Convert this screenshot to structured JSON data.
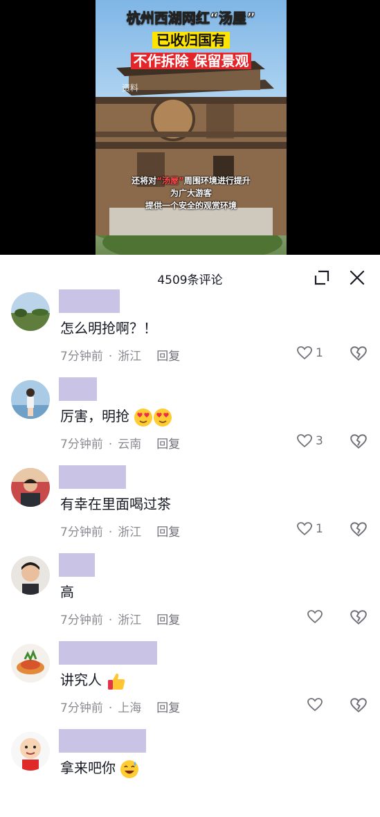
{
  "video": {
    "title_line1": "杭州西湖网红“汤屋”",
    "title_line2": "已收归国有",
    "title_line3": "不作拆除 保留景观",
    "watermark": "资料",
    "subtitle_prefix": "还将对",
    "subtitle_highlight": "“汤屋”",
    "subtitle_suffix": "周围环境进行提升",
    "subtitle_line2": "为广大游客",
    "subtitle_line3": "提供一个安全的观赏环境"
  },
  "panel": {
    "count_label": "4509条评论",
    "expand_icon": "expand-icon",
    "close_icon": "close-icon"
  },
  "colors": {
    "username_placeholder": "#c9c3e6",
    "text_primary": "#161823",
    "text_meta": "#8a8b91"
  },
  "comments": [
    {
      "text": "怎么明抢啊？！",
      "time": "7分钟前",
      "location": "浙江",
      "reply": "回复",
      "likes": "1",
      "avatar": "landscape-avatar"
    },
    {
      "text": "厉害，明抢",
      "emoji": "heart-eyes",
      "emoji_count": 2,
      "time": "7分钟前",
      "location": "云南",
      "reply": "回复",
      "likes": "3",
      "avatar": "girl-avatar"
    },
    {
      "text": "有幸在里面喝过茶",
      "time": "7分钟前",
      "location": "浙江",
      "reply": "回复",
      "likes": "1",
      "avatar": "man-avatar"
    },
    {
      "text": "高",
      "time": "7分钟前",
      "location": "浙江",
      "reply": "回复",
      "likes": "",
      "avatar": "man-glasses-avatar"
    },
    {
      "text": "讲究人",
      "emoji": "thumbs-up",
      "emoji_count": 1,
      "time": "7分钟前",
      "location": "上海",
      "reply": "回复",
      "likes": "",
      "avatar": "food-avatar"
    },
    {
      "text": "拿来吧你",
      "emoji": "grin-sweat",
      "emoji_count": 1,
      "time": "",
      "location": "",
      "reply": "",
      "likes": "",
      "avatar": "cartoon-avatar"
    }
  ]
}
